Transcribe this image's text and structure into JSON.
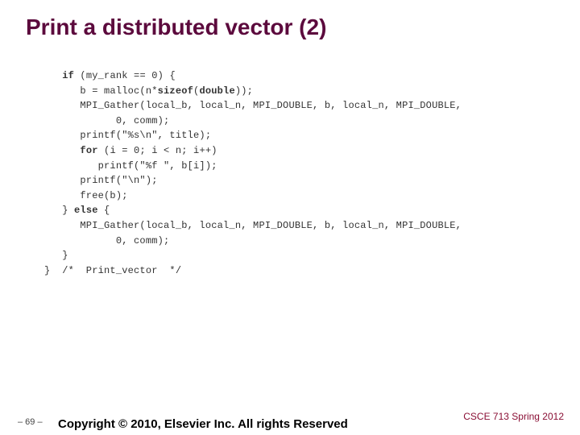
{
  "title": "Print a distributed vector (2)",
  "code": {
    "l1a": "if",
    "l1b": " (my_rank == 0) {",
    "l2a": "      b = malloc(n*",
    "l2b": "sizeof",
    "l2c": "(",
    "l2d": "double",
    "l2e": "));",
    "l3": "      MPI_Gather(local_b, local_n, MPI_DOUBLE, b, local_n, MPI_DOUBLE,",
    "l4": "            0, comm);",
    "l5": "      printf(\"%s\\n\", title);",
    "l6a": "      ",
    "l6b": "for",
    "l6c": " (i = 0; i < n; i++)",
    "l7": "         printf(\"%f \", b[i]);",
    "l8": "      printf(\"\\n\");",
    "l9": "      free(b);",
    "l10a": "   } ",
    "l10b": "else",
    "l10c": " {",
    "l11": "      MPI_Gather(local_b, local_n, MPI_DOUBLE, b, local_n, MPI_DOUBLE,",
    "l12": "            0, comm);",
    "l13": "   }",
    "l14": "}  /*  Print_vector  */"
  },
  "footer": {
    "page": "– 69 –",
    "copyright": "Copyright © 2010, Elsevier Inc. All rights Reserved",
    "course": "CSCE 713 Spring 2012"
  }
}
